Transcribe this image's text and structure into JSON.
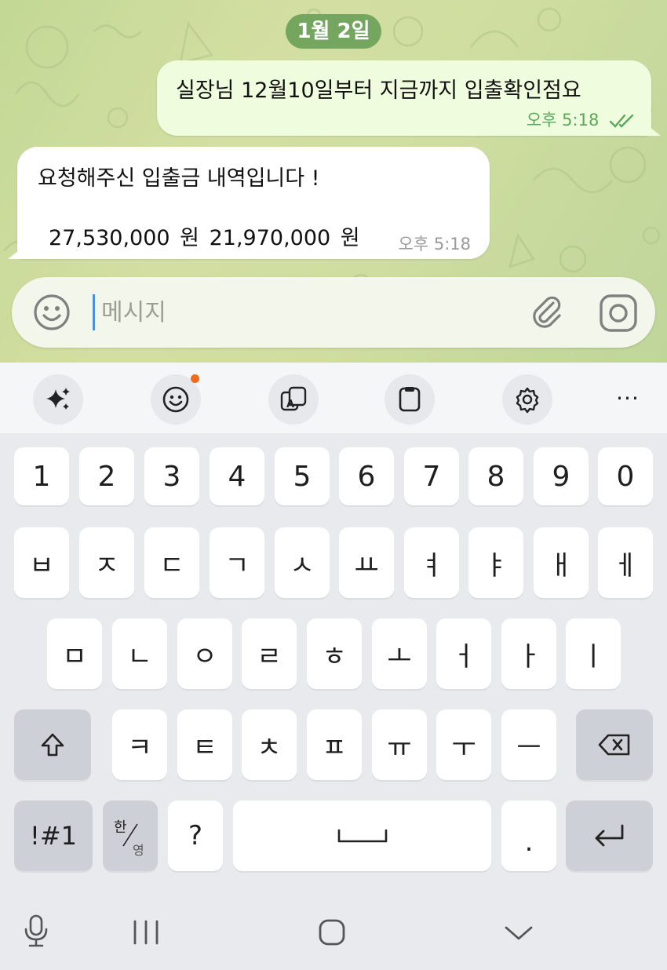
{
  "chat": {
    "date_label": "1월 2일",
    "messages": [
      {
        "direction": "outgoing",
        "text": "실장님 12월10일부터 지금까지 입출확인점요",
        "time": "오후 5:18",
        "status": "read"
      },
      {
        "direction": "incoming",
        "lines": [
          "요청해주신 입출금 내역입니다 !",
          "27,530,000 원   21,970,000 원"
        ],
        "time": "오후 5:18"
      }
    ]
  },
  "composer": {
    "placeholder": "메시지",
    "value": "",
    "icons": [
      "emoji-icon",
      "paperclip-icon",
      "camera-icon"
    ]
  },
  "keyboard": {
    "toolbar": [
      "sparkles-icon",
      "emoji-icon",
      "translate-icon",
      "clipboard-icon",
      "settings-icon",
      "more-icon"
    ],
    "toolbar_more_label": "···",
    "accent_color": "#f26a1b",
    "number_row": [
      "1",
      "2",
      "3",
      "4",
      "5",
      "6",
      "7",
      "8",
      "9",
      "0"
    ],
    "row1": [
      "ㅂ",
      "ㅈ",
      "ㄷ",
      "ㄱ",
      "ㅅ",
      "ㅛ",
      "ㅕ",
      "ㅑ",
      "ㅐ",
      "ㅔ"
    ],
    "row2": [
      "ㅁ",
      "ㄴ",
      "ㅇ",
      "ㄹ",
      "ㅎ",
      "ㅗ",
      "ㅓ",
      "ㅏ",
      "ㅣ"
    ],
    "row3": [
      "ㅋ",
      "ㅌ",
      "ㅊ",
      "ㅍ",
      "ㅠ",
      "ㅜ",
      "ㅡ"
    ],
    "symbols_label": "!#1",
    "lang_label_top": "한",
    "lang_label_bottom": "영",
    "question_label": "?",
    "period_label": "."
  },
  "navbar": [
    "microphone-icon",
    "recent-apps-icon",
    "home-icon",
    "hide-keyboard-icon"
  ]
}
